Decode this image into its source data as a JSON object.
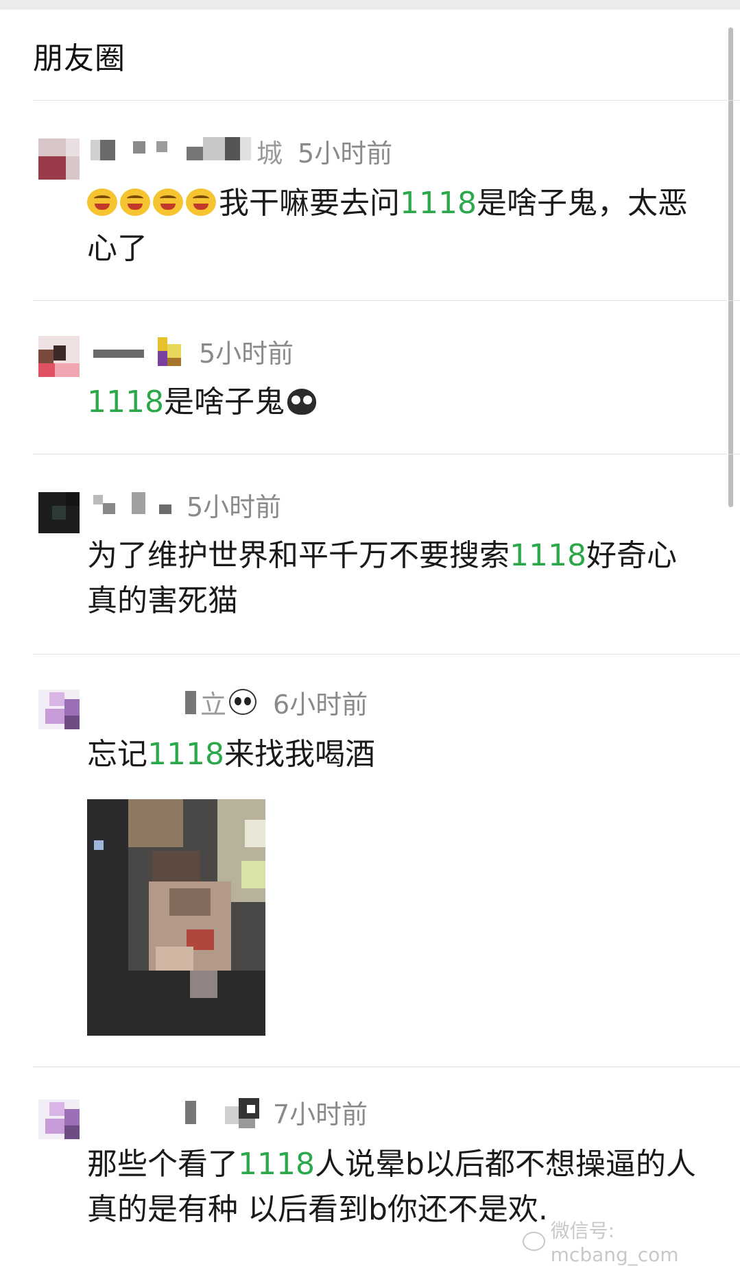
{
  "title": "朋友圈",
  "posts": [
    {
      "name_suffix": "城",
      "time": "5小时前",
      "text_parts": [
        "我干嘛要去问",
        "1118",
        "是啥子鬼，太恶心了"
      ],
      "emoji_prefix": "grinning-squint-emoji x4"
    },
    {
      "name_suffix": "",
      "time": "5小时前",
      "text_parts": [
        "",
        "1118",
        "是啥子鬼"
      ],
      "emoji_suffix": "owl-emoji"
    },
    {
      "name_suffix": "",
      "time": "5小时前",
      "text_parts": [
        "为了维护世界和平千万不要搜索",
        "1118",
        "好奇心真的害死猫"
      ]
    },
    {
      "name_suffix": "立",
      "time": "6小时前",
      "text_parts": [
        "忘记",
        "1118",
        "来找我喝酒"
      ],
      "name_emoji": "panda-emoji"
    },
    {
      "name_suffix": "",
      "time": "7小时前",
      "text_parts": [
        "那些个看了",
        "1118",
        "人说晕b以后都不想操逼的人 真的是有种 以后看到b你还不是欢."
      ]
    }
  ],
  "watermark": "微信号: mcbang_com",
  "colors": {
    "highlight": "#2aa84a",
    "time": "#8a8a8a",
    "text": "#1a1a1a",
    "divider": "#e3e3e3"
  }
}
